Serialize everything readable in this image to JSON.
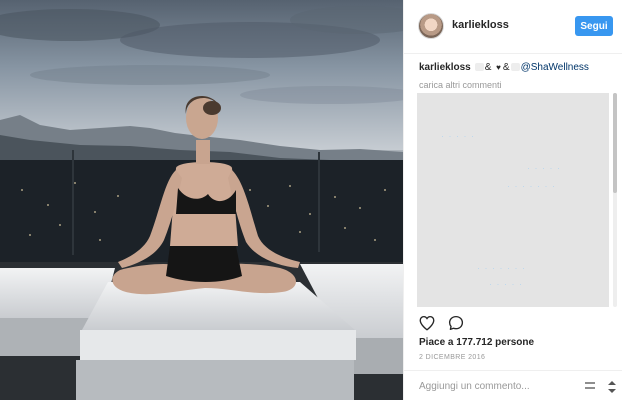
{
  "post": {
    "username": "karliekloss",
    "follow_label": "Segui",
    "caption": {
      "user": "karliekloss",
      "sep1": "&",
      "heart": "♥",
      "sep2": "&",
      "mention": "@ShaWellness"
    },
    "load_more_label": "carica altri commenti",
    "likes_text": "Piace a 177.712 persone",
    "date": "2 DICEMBRE 2016",
    "comment_placeholder": "Aggiungi un commento..."
  },
  "icons": {
    "like": "heart-icon",
    "comment": "comment-icon",
    "more": "more-options-icon"
  },
  "colors": {
    "accent": "#3897f0",
    "text": "#262626",
    "muted": "#999999",
    "mention": "#003569"
  }
}
